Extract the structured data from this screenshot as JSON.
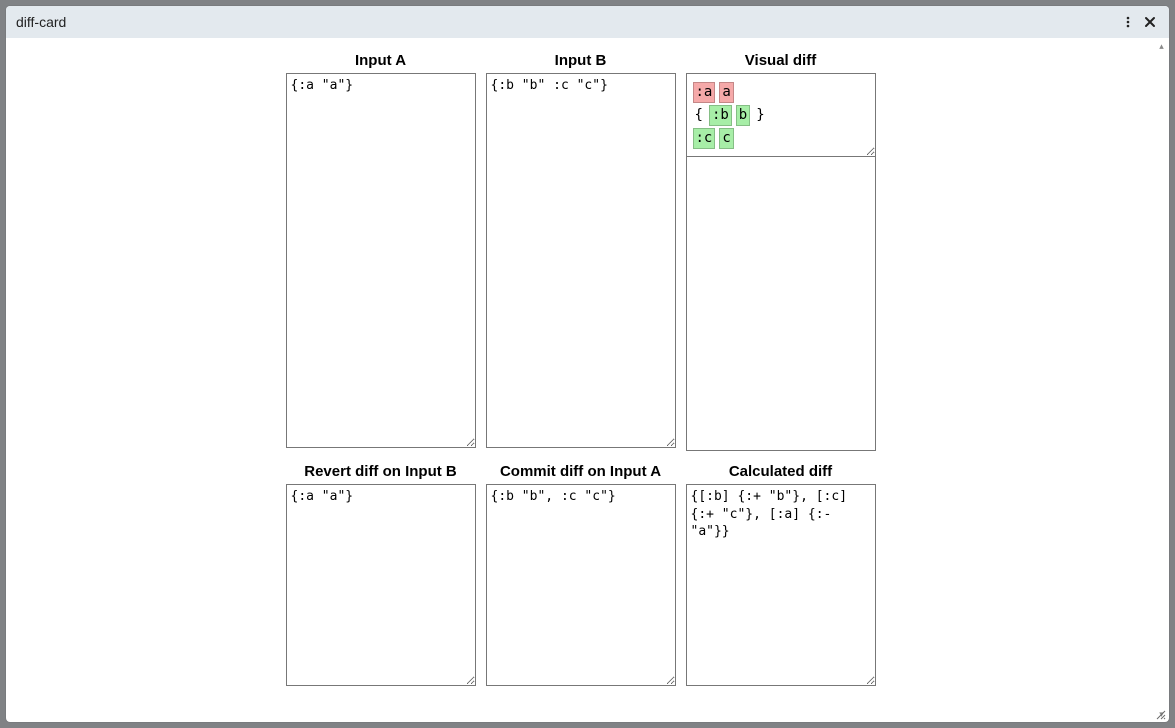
{
  "window": {
    "title": "diff-card"
  },
  "labels": {
    "inputA": "Input A",
    "inputB": "Input B",
    "visualDiff": "Visual diff",
    "revert": "Revert diff on Input B",
    "commit": "Commit diff on Input A",
    "calculated": "Calculated diff"
  },
  "values": {
    "inputA": "{:a \"a\"}",
    "inputB": "{:b \"b\" :c \"c\"}",
    "revert": "{:a \"a\"}",
    "commit": "{:b \"b\", :c \"c\"}",
    "calculated": "{[:b] {:+ \"b\"}, [:c] {:+ \"c\"}, [:a] {:- \"a\"}}"
  },
  "diff": {
    "rows": [
      {
        "prefix": "",
        "key": ":a",
        "val": "a",
        "type": "del",
        "suffix": ""
      },
      {
        "prefix": "{",
        "key": ":b",
        "val": "b",
        "type": "add",
        "suffix": "}"
      },
      {
        "prefix": "",
        "key": ":c",
        "val": "c",
        "type": "add",
        "suffix": ""
      }
    ]
  }
}
